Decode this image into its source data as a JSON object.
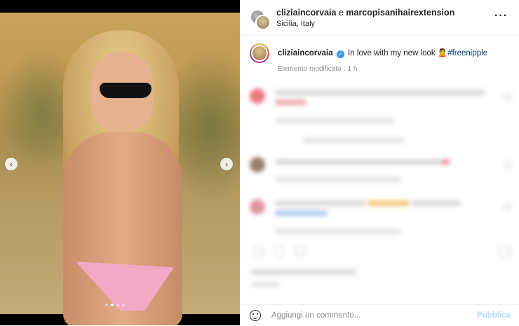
{
  "header": {
    "user_a": "cliziaincorvaia",
    "connector": " e ",
    "user_b": "marcopisanihairextension",
    "location": "Sicilia, Italy",
    "more_icon": "more-horizontal-icon"
  },
  "caption": {
    "username": "cliziaincorvaia",
    "text": "In love with my new look 🙎",
    "hashtag": "#freenipple",
    "meta": "Elemento modificato · 1 h"
  },
  "comment_box": {
    "placeholder": "Aggiungi un commento...",
    "publish_label": "Pubblica"
  },
  "media": {
    "prev_icon": "‹",
    "next_icon": "›",
    "slides": 4,
    "active_slide": 2
  },
  "colors": {
    "link": "#00376b",
    "verified": "#3897f0",
    "publish_disabled": "#b3dbff",
    "meta": "#8e8e8e"
  }
}
